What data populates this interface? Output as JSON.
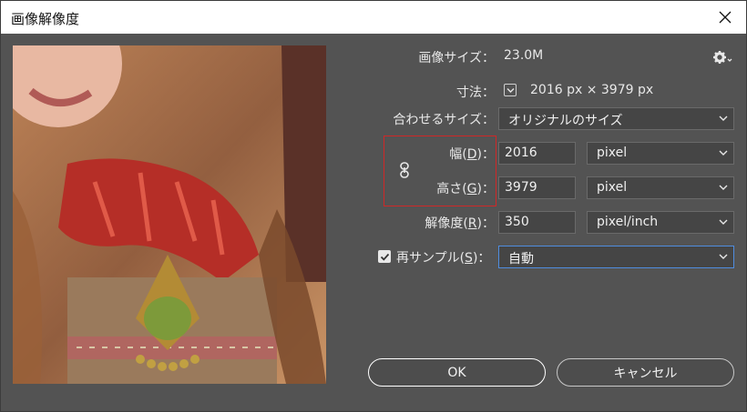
{
  "window": {
    "title": "画像解像度",
    "close_icon": "close-icon"
  },
  "image_size": {
    "label": "画像サイズ：",
    "value": "23.0M"
  },
  "dimensions": {
    "label": "寸法：",
    "value": "2016 px × 3979 px"
  },
  "fit_to": {
    "label": "合わせるサイズ：",
    "value": "オリジナルのサイズ"
  },
  "width": {
    "label_pre": "幅(",
    "key": "D",
    "label_post": ")：",
    "value": "2016",
    "unit": "pixel"
  },
  "height": {
    "label_pre": "高さ(",
    "key": "G",
    "label_post": ")：",
    "value": "3979",
    "unit": "pixel"
  },
  "resolution": {
    "label_pre": "解像度(",
    "key": "R",
    "label_post": ")：",
    "value": "350",
    "unit": "pixel/inch"
  },
  "resample": {
    "label_pre": "再サンプル(",
    "key": "S",
    "label_post": ")：",
    "checked": true,
    "value": "自動"
  },
  "buttons": {
    "ok": "OK",
    "cancel": "キャンセル"
  },
  "colors": {
    "dialog_bg": "#535353",
    "highlight_box": "#d02727",
    "focus_border": "#4f8de0"
  }
}
